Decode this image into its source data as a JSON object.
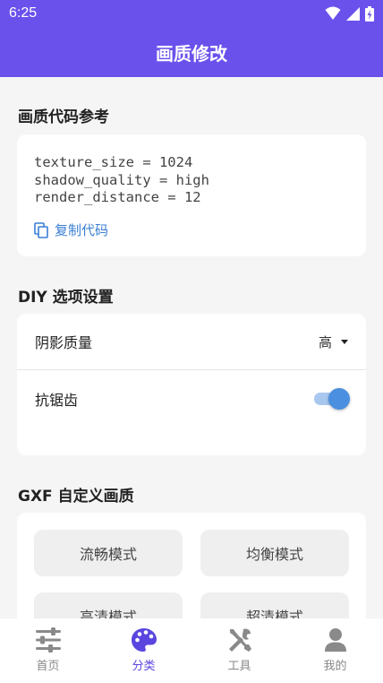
{
  "status_bar": {
    "time": "6:25"
  },
  "app_bar": {
    "title": "画质修改"
  },
  "sections": {
    "code": {
      "title": "画质代码参考",
      "lines": [
        "texture_size = 1024",
        "shadow_quality = high",
        "render_distance = 12"
      ],
      "copy_label": "复制代码"
    },
    "diy": {
      "title": "DIY 选项设置",
      "shadow_label": "阴影质量",
      "shadow_value": "高",
      "antialias_label": "抗锯齿",
      "antialias_on": true
    },
    "gxf": {
      "title": "GXF 自定义画质",
      "modes": [
        "流畅模式",
        "均衡模式",
        "高清模式",
        "超清模式"
      ]
    }
  },
  "nav": {
    "items": [
      {
        "label": "首页",
        "icon": "sliders-icon"
      },
      {
        "label": "分类",
        "icon": "palette-icon"
      },
      {
        "label": "工具",
        "icon": "tools-icon"
      },
      {
        "label": "我的",
        "icon": "person-icon"
      }
    ],
    "active_index": 1
  },
  "colors": {
    "primary": "#6b51ec",
    "accent_blue": "#3a7fd5",
    "nav_active": "#5a45e0"
  }
}
